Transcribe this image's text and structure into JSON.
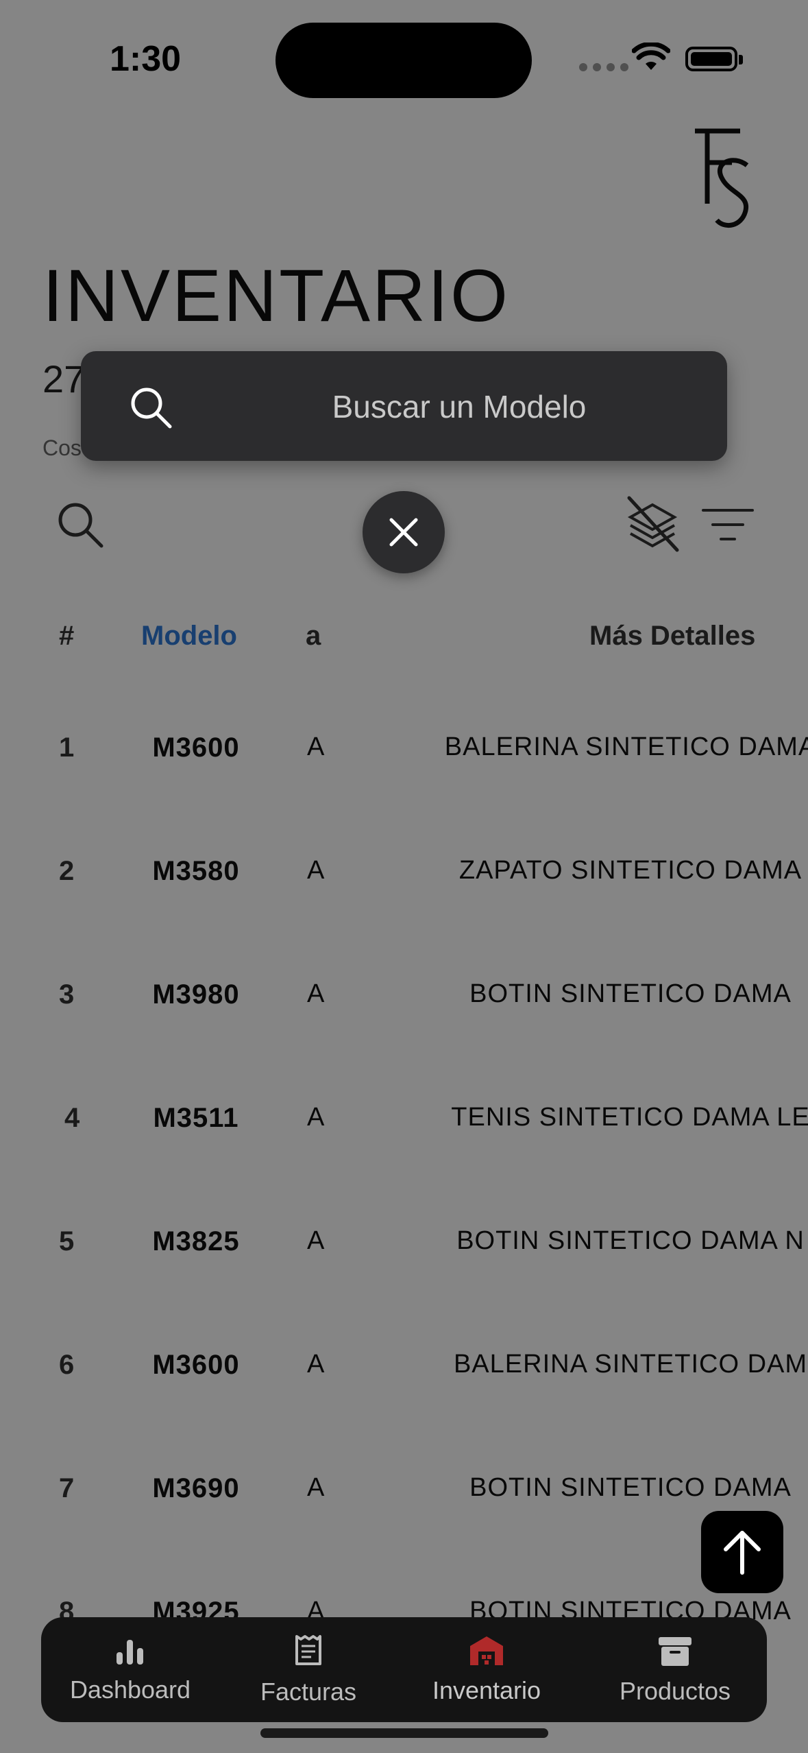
{
  "status_bar": {
    "time": "1:30"
  },
  "page": {
    "title": "INVENTARIO",
    "count_partial": "27",
    "cost_label_partial": "Cos"
  },
  "table": {
    "headers": {
      "num": "#",
      "model": "Modelo",
      "col_a": "a",
      "details": "Más Detalles"
    },
    "rows": [
      {
        "num": "1",
        "model": "M3600",
        "col_a": "A",
        "details": "BALERINA SINTETICO DAMA"
      },
      {
        "num": "2",
        "model": "M3580",
        "col_a": "A",
        "details": "ZAPATO SINTETICO DAMA"
      },
      {
        "num": "3",
        "model": "M3980",
        "col_a": "A",
        "details": "BOTIN SINTETICO DAMA"
      },
      {
        "num": "4",
        "model": "M3511",
        "col_a": "A",
        "details": "TENIS SINTETICO DAMA LE"
      },
      {
        "num": "5",
        "model": "M3825",
        "col_a": "A",
        "details": "BOTIN SINTETICO DAMA N"
      },
      {
        "num": "6",
        "model": "M3600",
        "col_a": "A",
        "details": "BALERINA SINTETICO DAM"
      },
      {
        "num": "7",
        "model": "M3690",
        "col_a": "A",
        "details": "BOTIN SINTETICO DAMA"
      },
      {
        "num": "8",
        "model": "M3925",
        "col_a": "A",
        "details": "BOTIN SINTETICO DAMA"
      }
    ]
  },
  "search": {
    "placeholder": "Buscar un Modelo"
  },
  "tabs": [
    {
      "label": "Dashboard",
      "icon": "bar-chart-icon"
    },
    {
      "label": "Facturas",
      "icon": "receipt-icon"
    },
    {
      "label": "Inventario",
      "icon": "warehouse-icon",
      "active": true
    },
    {
      "label": "Productos",
      "icon": "archive-box-icon"
    }
  ],
  "colors": {
    "accent_blue": "#2f7ad6",
    "active_tab_icon": "#b02a2a",
    "popup_bg": "#2c2c2e"
  }
}
